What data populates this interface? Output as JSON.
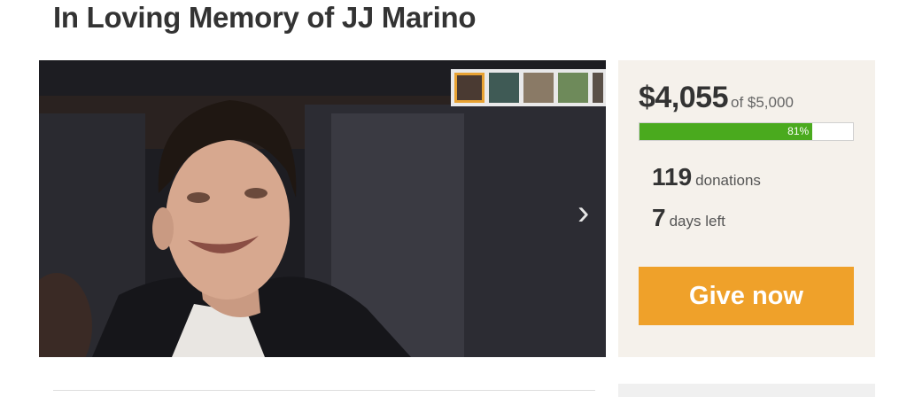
{
  "campaign": {
    "title": "In Loving Memory of JJ Marino"
  },
  "gallery": {
    "thumbnail_count": 5,
    "active_index": 0,
    "next_icon": "chevron-right-icon",
    "next_glyph": "›"
  },
  "funding": {
    "raised": "$4,055",
    "goal": "of $5,000",
    "progress_fraction": 0.81,
    "progress_label": "81%",
    "donations_count": "119",
    "donations_label": "donations",
    "days_left_count": "7",
    "days_left_label": "days left",
    "give_button_label": "Give now"
  },
  "colors": {
    "progress_green": "#4aaa1e",
    "button_orange": "#efa12a",
    "card_bg": "#f5f1eb",
    "thumb_active_border": "#e8a233"
  }
}
